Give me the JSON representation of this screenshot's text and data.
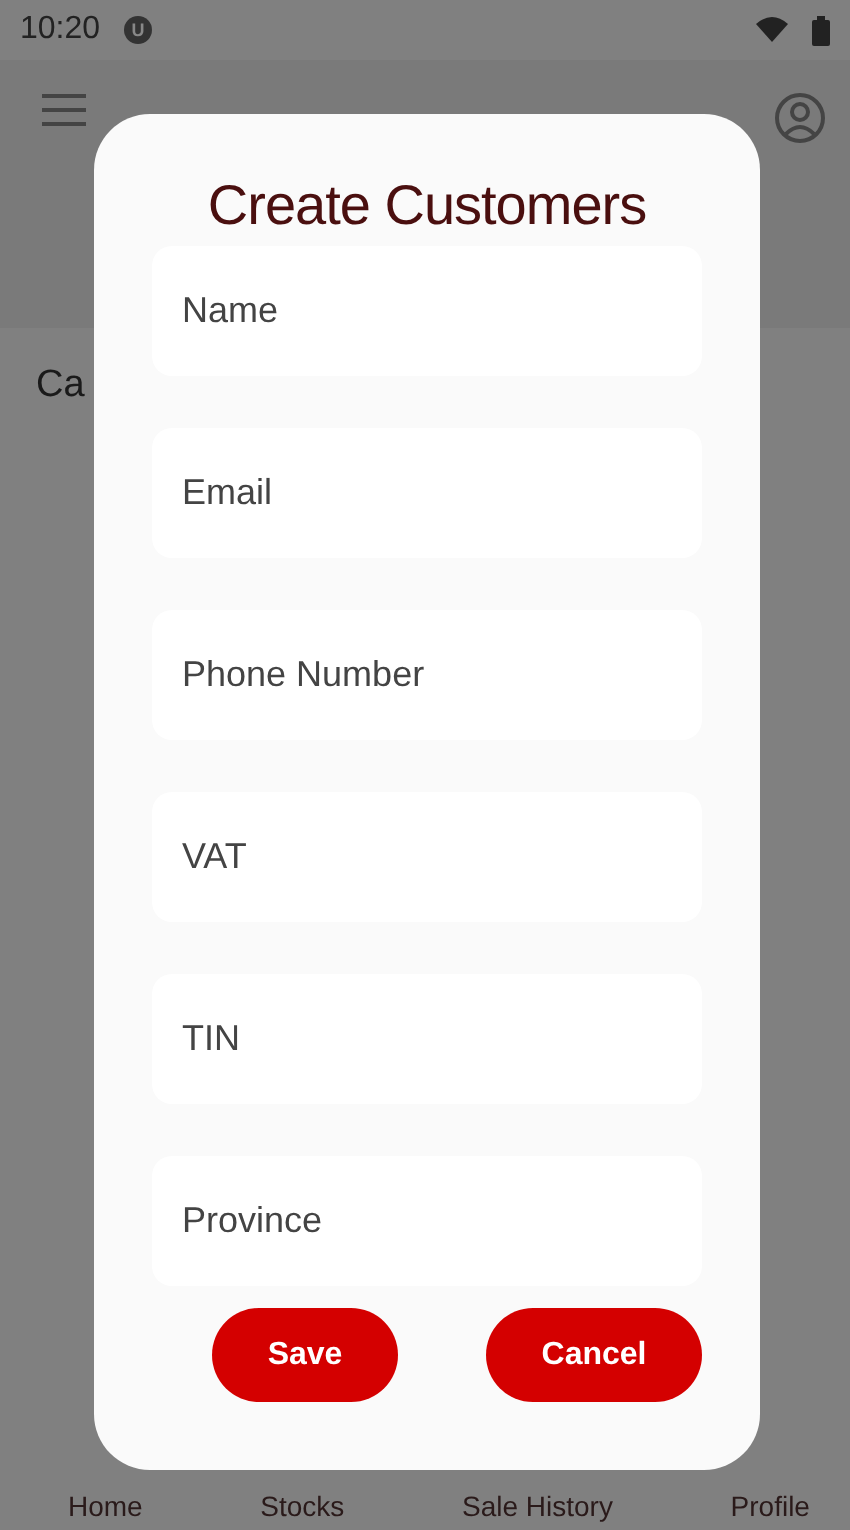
{
  "status_bar": {
    "time": "10:20",
    "notification_badge": "U"
  },
  "page": {
    "partial_heading": "Ca"
  },
  "dialog": {
    "title": "Create Customers",
    "fields": [
      {
        "placeholder": "Name"
      },
      {
        "placeholder": "Email"
      },
      {
        "placeholder": "Phone Number"
      },
      {
        "placeholder": "VAT"
      },
      {
        "placeholder": "TIN"
      },
      {
        "placeholder": "Province"
      }
    ],
    "buttons": [
      {
        "label": "Save"
      },
      {
        "label": "Cancel"
      }
    ]
  },
  "bottom_nav": {
    "items": [
      {
        "label": "Home"
      },
      {
        "label": "Stocks"
      },
      {
        "label": "Sale History"
      },
      {
        "label": "Profile"
      }
    ]
  }
}
